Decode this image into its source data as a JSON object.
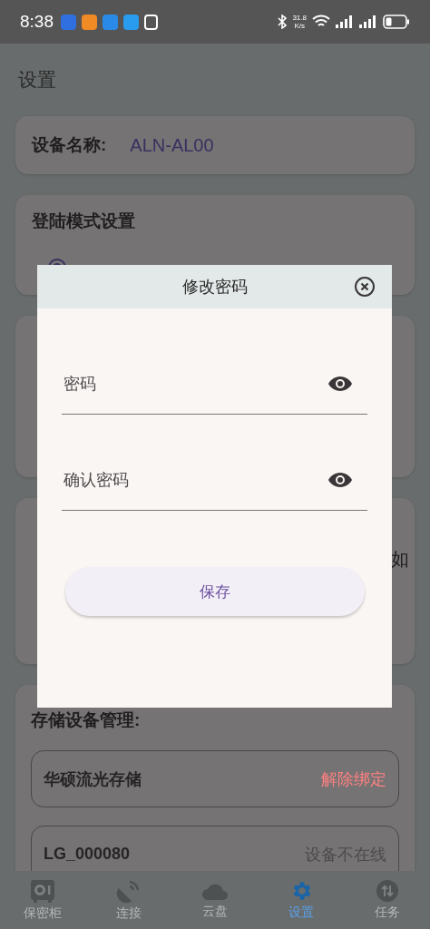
{
  "status_bar": {
    "time": "8:38",
    "net_speed": "31.8",
    "net_unit": "K/s"
  },
  "page_title": "设置",
  "device_name": {
    "label": "设备名称:",
    "value": "ALN-AL00"
  },
  "login_mode": {
    "title": "登陆模式设置",
    "options": [
      {
        "selected": true
      }
    ]
  },
  "card_4": {
    "text_fragment": "如"
  },
  "storage": {
    "title": "存储设备管理:",
    "devices": [
      {
        "name": "华硕流光存储",
        "status": "解除绑定",
        "kind": "action"
      },
      {
        "name": "LG_000080",
        "status": "设备不在线",
        "kind": "offline"
      }
    ]
  },
  "dialog": {
    "title": "修改密码",
    "fields": [
      {
        "placeholder": "密码"
      },
      {
        "placeholder": "确认密码"
      }
    ],
    "save": "保存"
  },
  "nav": [
    {
      "label": "保密柜",
      "selected": false
    },
    {
      "label": "连接",
      "selected": false
    },
    {
      "label": "云盘",
      "selected": false
    },
    {
      "label": "设置",
      "selected": true
    },
    {
      "label": "任务",
      "selected": false
    }
  ]
}
